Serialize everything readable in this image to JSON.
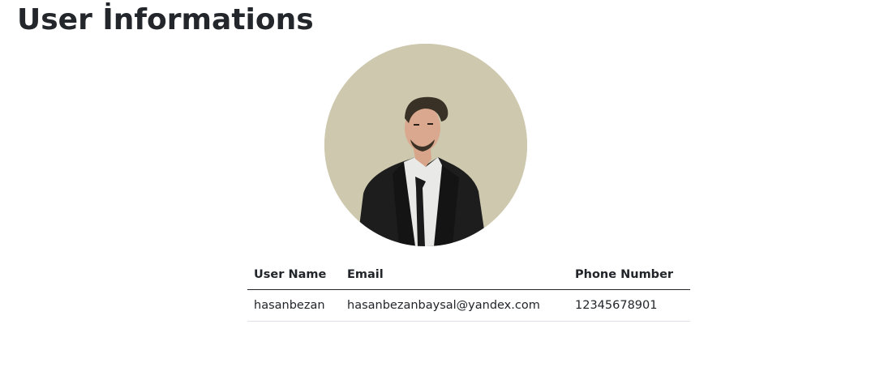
{
  "page": {
    "title": "User İnformations"
  },
  "avatar": {
    "background_color": "#cdc8ae"
  },
  "table": {
    "headers": {
      "user_name": "User Name",
      "email": "Email",
      "phone": "Phone Number"
    },
    "rows": [
      {
        "user_name": "hasanbezan",
        "email": "hasanbezanbaysal@yandex.com",
        "phone": "12345678901"
      }
    ]
  }
}
